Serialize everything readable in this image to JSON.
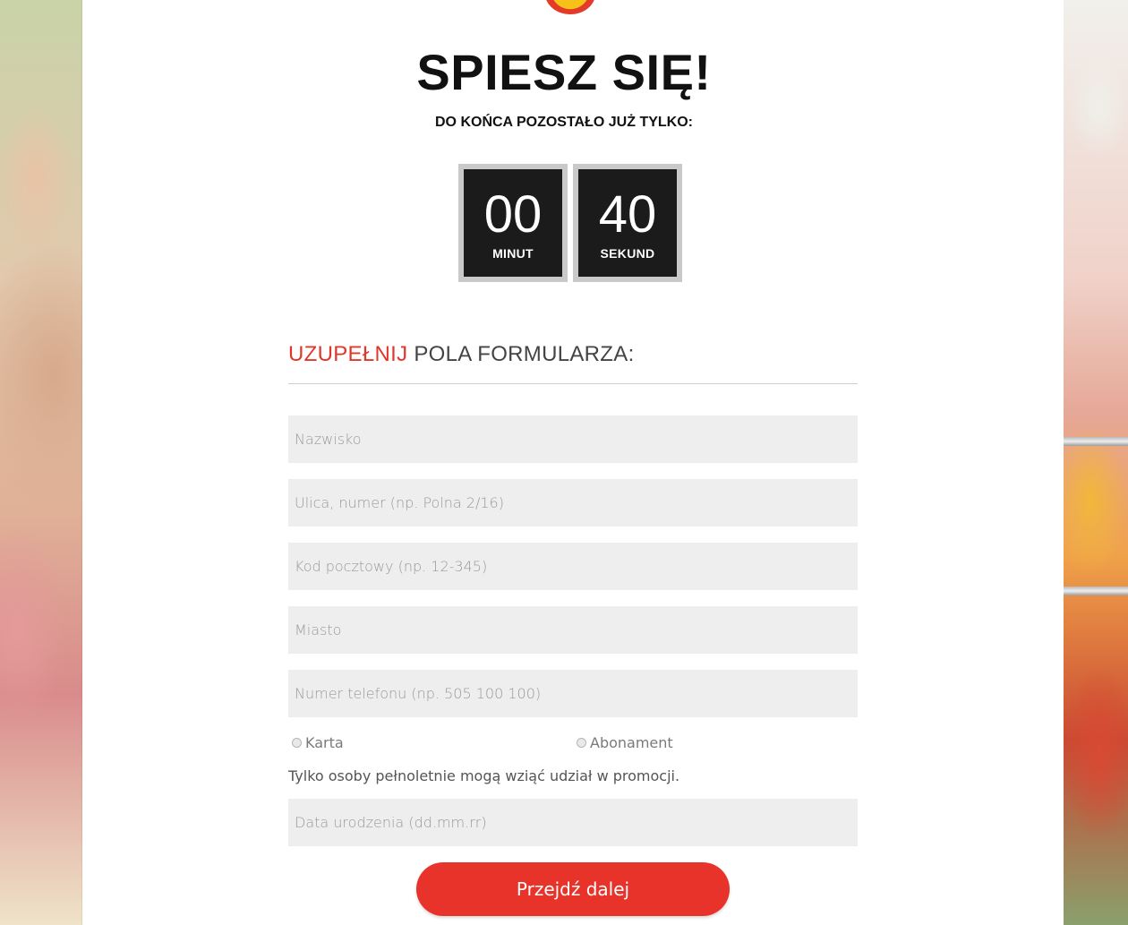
{
  "hero": {
    "title": "SPIESZ SIĘ!",
    "subtitle": "DO KOŃCA POZOSTAŁO JUŻ TYLKO:"
  },
  "timer": {
    "minutes": "00",
    "minutes_label": "MINUT",
    "seconds": "40",
    "seconds_label": "SEKUND"
  },
  "form": {
    "heading_accent": "UZUPEŁNIJ",
    "heading_rest": " POLA FORMULARZA:",
    "fields": {
      "surname": {
        "placeholder": "Nazwisko",
        "value": ""
      },
      "street": {
        "placeholder": "Ulica, numer (np. Polna 2/16)",
        "value": ""
      },
      "postal": {
        "placeholder": "Kod pocztowy (np. 12-345)",
        "value": ""
      },
      "city": {
        "placeholder": "Miasto",
        "value": ""
      },
      "phone": {
        "placeholder": "Numer telefonu (np. 505 100 100)",
        "value": ""
      },
      "birthdate": {
        "placeholder": "Data urodzenia (dd.mm.rr)",
        "value": ""
      }
    },
    "radio": {
      "card_label": "Karta",
      "subscription_label": "Abonament"
    },
    "adult_note": "Tylko osoby pełnoletnie mogą wziąć udział w promocji.",
    "submit_label": "Przejdź dalej"
  },
  "colors": {
    "accent": "#e0372b",
    "button": "#e8332a",
    "timer_bg": "#1b1b1b",
    "field_bg": "#eeeeee"
  }
}
